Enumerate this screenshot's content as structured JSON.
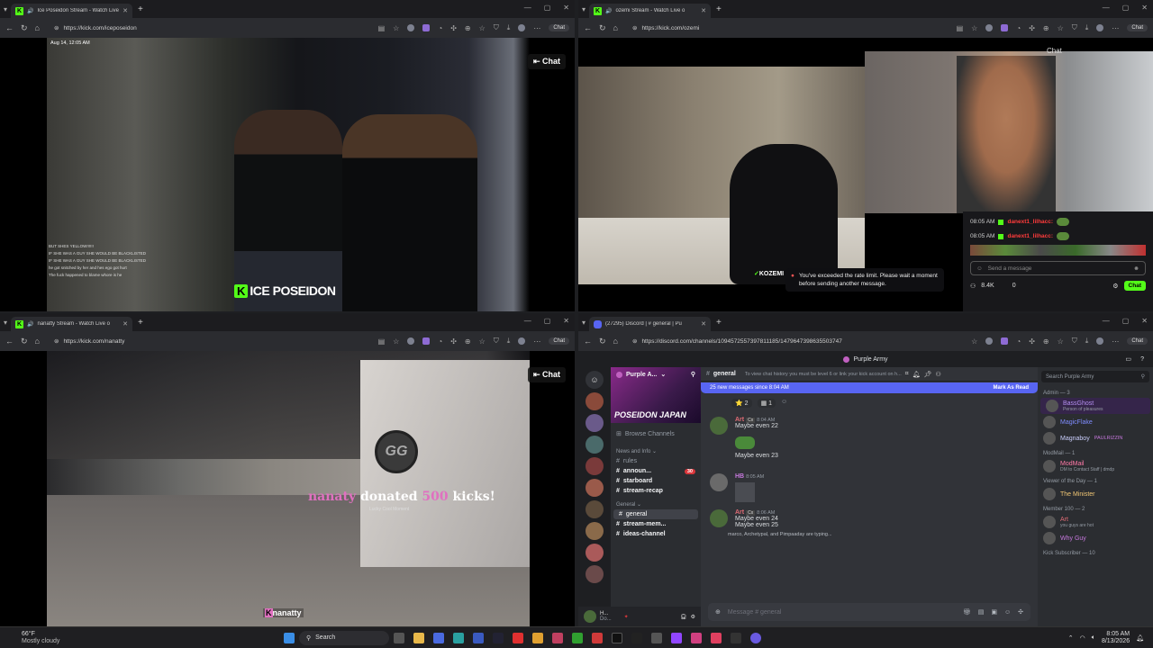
{
  "windows": [
    {
      "tab_title": "Ice Poseidon Stream - Watch Live",
      "url": "https://kick.com/iceposeidon",
      "chat_button": "Chat",
      "timestamp_overlay": "Aug 14, 12:05 AM",
      "overlay_name": "ICE POSEIDON",
      "chat_lines": [
        "BUT SHES YELLOW!!!!!!",
        "IF SHE WAS A GUY SHE WOULD BE BLACKLISTED",
        "IF SHE WAS A GUY SHE WOULD BE BLACKLISTED",
        "he got snitched by her and hes ego got hurt",
        "The fuck happened to blame whore is he"
      ]
    },
    {
      "tab_title": "ozemi Stream - Watch Live o",
      "url": "https://kick.com/ozemi",
      "overlay_name": "KOZEMI",
      "chat_messages": [
        {
          "time": "08:05 AM",
          "user": "danext1_lilhacc:"
        },
        {
          "time": "08:05 AM",
          "user": "danext1_lilhacc:"
        }
      ],
      "chat_placeholder": "Send a message",
      "rate_limit": "You've exceeded the rate limit. Please wait a moment before sending another message.",
      "viewers": "8.4K",
      "count": "0",
      "chat_send": "Chat",
      "header_chat": "Chat"
    },
    {
      "tab_title": "nanatty Stream - Watch Live o",
      "url": "https://kick.com/nanatty",
      "chat_button": "Chat",
      "donation_user": "nanaty",
      "donation_text": "donated",
      "donation_amount": "500",
      "donation_unit": "kicks!",
      "donation_sub": "Lucky Cool Moment",
      "watermark": "nanatty",
      "gg_badge": "GG"
    },
    {
      "tab_title": "(27295) Discord | # general | Pu",
      "url": "https://discord.com/channels/1094572557397811185/1479647398635503747",
      "window_title": "Purple Army",
      "server_name": "Purple A...",
      "banner_text": "POSEIDON JAPAN",
      "channel_header": "general",
      "channel_topic": "To view chat history you must be level 6 or link your kick account on h...",
      "search_placeholder": "Search Purple Army",
      "new_messages": "25 new messages since 8:04 AM",
      "mark_read": "Mark As Read",
      "reactions": [
        "2",
        "1"
      ],
      "browse": "Browse Channels",
      "categories": [
        {
          "name": "News and Info",
          "channels": [
            {
              "name": "rules",
              "badge": ""
            },
            {
              "name": "announ...",
              "badge": "30"
            },
            {
              "name": "starboard",
              "badge": ""
            },
            {
              "name": "stream-recap",
              "badge": ""
            }
          ]
        },
        {
          "name": "General",
          "channels": [
            {
              "name": "general",
              "badge": ""
            },
            {
              "name": "stream-mem...",
              "badge": ""
            },
            {
              "name": "ideas-channel",
              "badge": ""
            }
          ]
        }
      ],
      "messages": [
        {
          "user": "Art",
          "time": "8:04 AM",
          "lines": [
            "Maybe even 22"
          ]
        },
        {
          "user": "",
          "time": "",
          "lines": [
            "Maybe even 23"
          ]
        },
        {
          "user": "HB",
          "time": "8:05 AM",
          "lines": []
        },
        {
          "user": "Art",
          "time": "8:06 AM",
          "lines": [
            "Maybe even 24",
            "Maybe even 25"
          ]
        }
      ],
      "typing": "marco, Archetypal, and Pimpaaday are typing...",
      "message_placeholder": "Message # general",
      "user_short": "H...",
      "user_short2": "Do...",
      "member_groups": [
        {
          "name": "Admin — 3",
          "members": [
            {
              "name": "BassGhost",
              "sub": "Person of pleasures",
              "color": "#b48ef0"
            },
            {
              "name": "MagicFlake",
              "sub": "",
              "color": "#7f8cff"
            },
            {
              "name": "Magnaboy",
              "sub": "PAULRIZZIN",
              "color": "#c9cdfb"
            }
          ]
        },
        {
          "name": "ModMail — 1",
          "members": [
            {
              "name": "ModMail",
              "sub": "DM to Contact Staff | dmdp",
              "color": "#ff7aa8"
            }
          ]
        },
        {
          "name": "Viewer of the Day — 1",
          "members": [
            {
              "name": "The Minister",
              "sub": "",
              "color": "#f0c674"
            }
          ]
        },
        {
          "name": "Member 100 — 2",
          "members": [
            {
              "name": "Art",
              "sub": "you guys are hot",
              "color": "#e06c75"
            },
            {
              "name": "Why Guy",
              "sub": "",
              "color": "#c678dd"
            }
          ]
        },
        {
          "name": "Kick Subscriber — 10",
          "members": []
        }
      ]
    }
  ],
  "taskbar": {
    "weather_temp": "66°F",
    "weather_desc": "Mostly cloudy",
    "search": "Search",
    "time": "8:05 AM",
    "date": "8/13/2026"
  }
}
